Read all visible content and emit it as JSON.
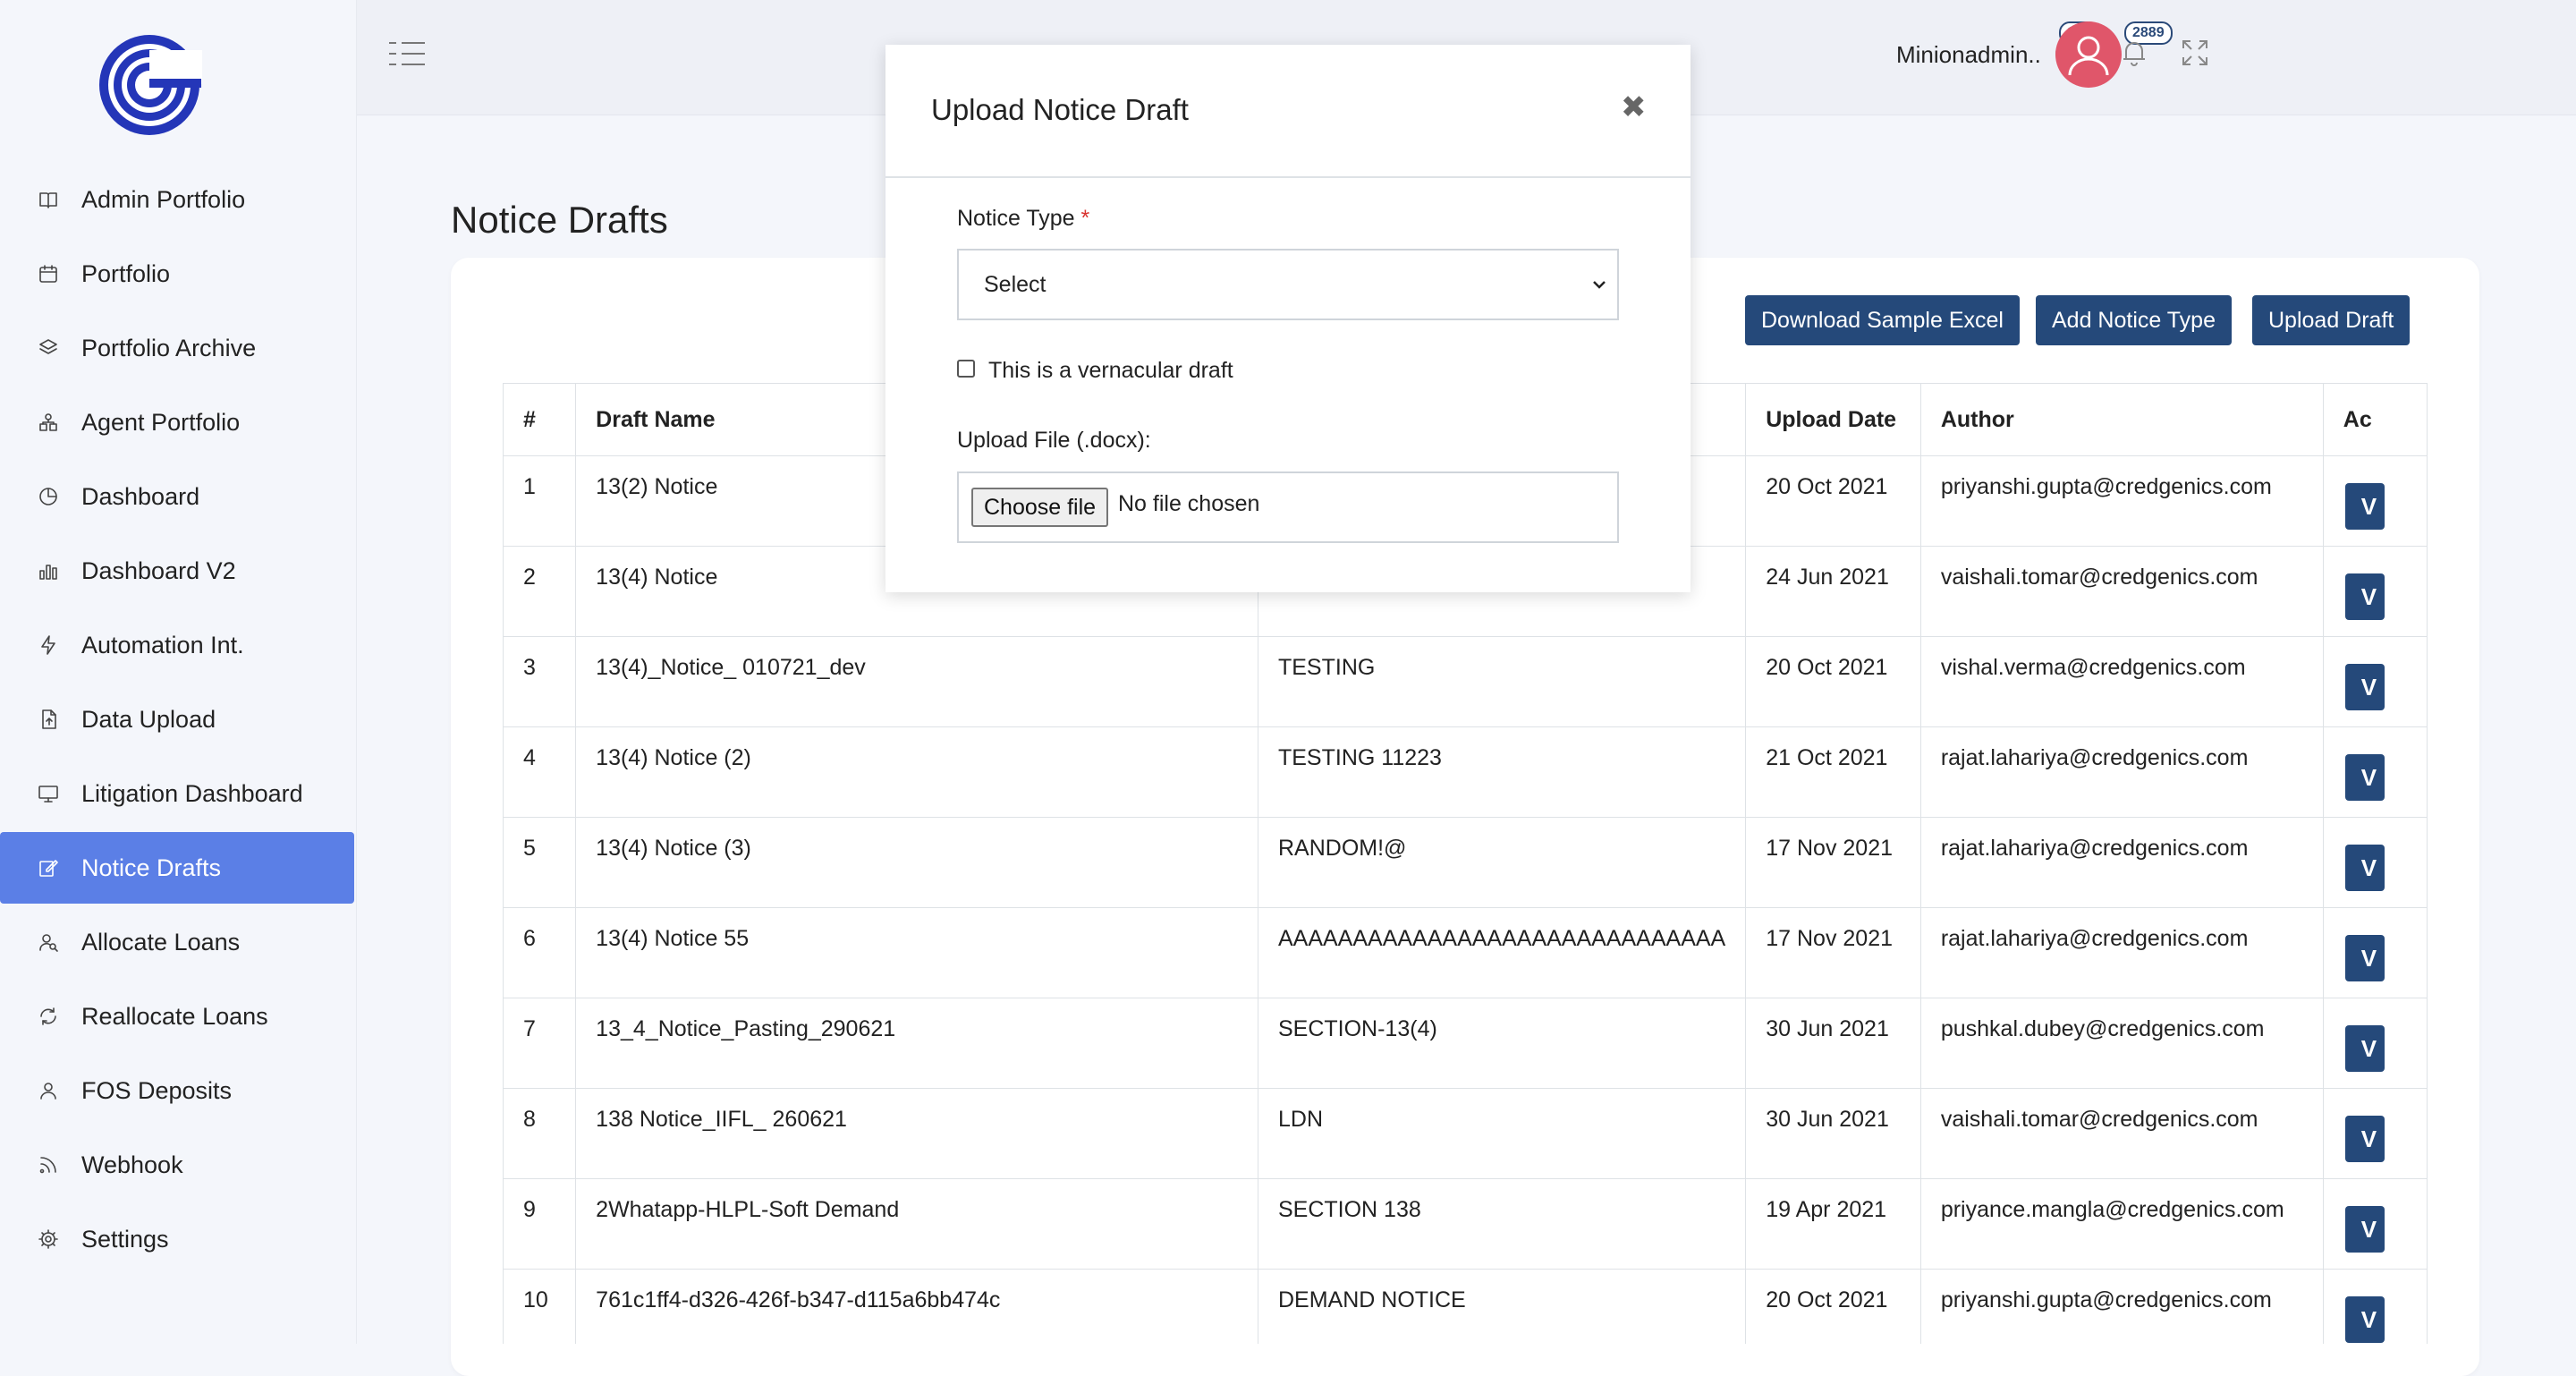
{
  "sidebar": {
    "items": [
      {
        "label": "Admin Portfolio",
        "icon": "book-icon"
      },
      {
        "label": "Portfolio",
        "icon": "calendar-icon"
      },
      {
        "label": "Portfolio Archive",
        "icon": "layers-icon"
      },
      {
        "label": "Agent Portfolio",
        "icon": "agents-icon"
      },
      {
        "label": "Dashboard",
        "icon": "clock-pie-icon"
      },
      {
        "label": "Dashboard V2",
        "icon": "bar-chart-icon"
      },
      {
        "label": "Automation Int.",
        "icon": "lightning-icon"
      },
      {
        "label": "Data Upload",
        "icon": "document-upload-icon"
      },
      {
        "label": "Litigation Dashboard",
        "icon": "monitor-icon"
      },
      {
        "label": "Notice Drafts",
        "icon": "edit-icon",
        "active": true
      },
      {
        "label": "Allocate Loans",
        "icon": "user-search-icon"
      },
      {
        "label": "Reallocate Loans",
        "icon": "refresh-icon"
      },
      {
        "label": "FOS Deposits",
        "icon": "user-icon"
      },
      {
        "label": "Webhook",
        "icon": "rss-icon"
      },
      {
        "label": "Settings",
        "icon": "gear-icon"
      }
    ]
  },
  "topbar": {
    "history_count": "196",
    "notification_count": "2889",
    "username": "Minionadmin.."
  },
  "page": {
    "title": "Notice Drafts",
    "buttons": {
      "download_sample": "Download Sample Excel",
      "add_notice_type": "Add Notice Type",
      "upload_draft": "Upload Draft"
    }
  },
  "table": {
    "headers": [
      "#",
      "Draft Name",
      "",
      "Upload Date",
      "Author",
      "Ac"
    ],
    "rows": [
      {
        "num": "1",
        "name": "13(2) Notice",
        "type": "",
        "date": "20 Oct 2021",
        "author": "priyanshi.gupta@credgenics.com"
      },
      {
        "num": "2",
        "name": "13(4) Notice",
        "type": "",
        "date": "24 Jun 2021",
        "author": "vaishali.tomar@credgenics.com"
      },
      {
        "num": "3",
        "name": "13(4)_Notice_ 010721_dev",
        "type": "TESTING",
        "date": "20 Oct 2021",
        "author": "vishal.verma@credgenics.com"
      },
      {
        "num": "4",
        "name": "13(4) Notice (2)",
        "type": "TESTING 11223",
        "date": "21 Oct 2021",
        "author": "rajat.lahariya@credgenics.com"
      },
      {
        "num": "5",
        "name": "13(4) Notice (3)",
        "type": "RANDOM!@",
        "date": "17 Nov 2021",
        "author": "rajat.lahariya@credgenics.com"
      },
      {
        "num": "6",
        "name": "13(4) Notice 55",
        "type": "AAAAAAAAAAAAAAAAAAAAAAAAAAAAAA",
        "date": "17 Nov 2021",
        "author": "rajat.lahariya@credgenics.com"
      },
      {
        "num": "7",
        "name": "13_4_Notice_Pasting_290621",
        "type": "SECTION-13(4)",
        "date": "30 Jun 2021",
        "author": "pushkal.dubey@credgenics.com"
      },
      {
        "num": "8",
        "name": "138 Notice_IIFL_ 260621",
        "type": "LDN",
        "date": "30 Jun 2021",
        "author": "vaishali.tomar@credgenics.com"
      },
      {
        "num": "9",
        "name": "2Whatapp-HLPL-Soft Demand",
        "type": "SECTION 138",
        "date": "19 Apr 2021",
        "author": "priyance.mangla@credgenics.com"
      },
      {
        "num": "10",
        "name": "761c1ff4-d326-426f-b347-d115a6bb474c",
        "type": "DEMAND NOTICE",
        "date": "20 Oct 2021",
        "author": "priyanshi.gupta@credgenics.com"
      }
    ],
    "action_label": "V"
  },
  "modal": {
    "title": "Upload Notice Draft",
    "close_glyph": "✖",
    "notice_type_label": "Notice Type",
    "required_mark": "*",
    "select_value": "Select",
    "vernacular_label": "This is a vernacular draft",
    "upload_label": "Upload File (.docx):",
    "choose_file": "Choose file",
    "no_file": "No file chosen"
  },
  "colors": {
    "primary": "#25497a",
    "active_nav": "#5b7fe6",
    "avatar": "#e0566a"
  }
}
